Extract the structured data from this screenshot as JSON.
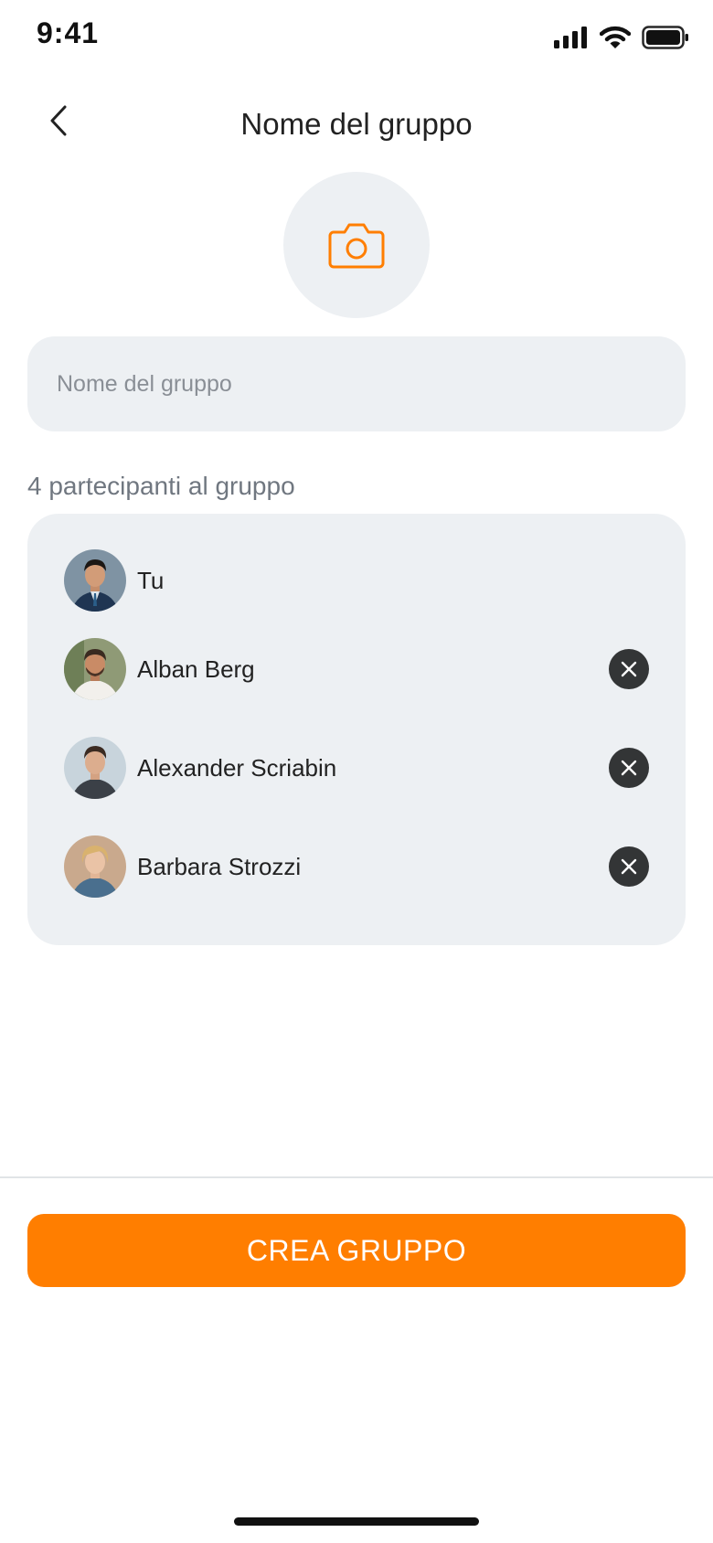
{
  "status_bar": {
    "time": "9:41",
    "icons": [
      "cellular-signal-icon",
      "wifi-icon",
      "battery-icon"
    ]
  },
  "header": {
    "back_icon": "chevron-left-icon",
    "title": "Nome del gruppo"
  },
  "photo_picker": {
    "icon": "camera-icon"
  },
  "group_name_field": {
    "value": "",
    "placeholder": "Nome del gruppo"
  },
  "participants": {
    "count_label": "4 partecipanti al gruppo",
    "items": [
      {
        "name": "Tu",
        "removable": false
      },
      {
        "name": "Alban Berg",
        "removable": true
      },
      {
        "name": "Alexander Scriabin",
        "removable": true
      },
      {
        "name": "Barbara Strozzi",
        "removable": true
      }
    ]
  },
  "create_button": {
    "label": "CREA GRUPPO"
  },
  "colors": {
    "accent": "#ff7e00",
    "field_background": "#edf0f3",
    "remove_button": "#333536",
    "muted_text": "#707780"
  }
}
